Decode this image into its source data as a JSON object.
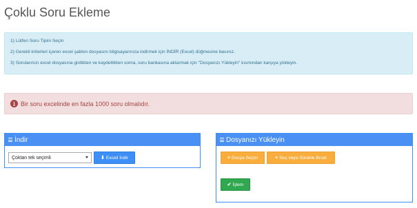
{
  "page": {
    "title": "Çoklu Soru Ekleme"
  },
  "info": {
    "lines": [
      "1) Lütfen Soru Tipini Seçin",
      "2) Gerekli kriterleri içeren excel şablon dosyasını bilgisayarınıza indirmek için İNDİR (Excel) düğmesine basınız.",
      "3) Sorularınızı excel dosyasına girdikten ve kaydettikten sonra, soru bankasına aktarmak için \"Dosyanızı Yükleyin\" kısmından karşıya yükleyin."
    ]
  },
  "alert": {
    "icon": "info-circle-icon",
    "text": "Bir soru excelinde en fazla 1000 soru olmalıdır."
  },
  "download_panel": {
    "title": "İndir",
    "select_value": "Çoktan tek seçimli",
    "button_label": "Exceli İndir",
    "button_icon": "download-icon"
  },
  "upload_panel": {
    "title": "Dosyanızı Yükleyin",
    "choose_label": "Dosya Seçici",
    "drag_label": "Seç veya Sürekle Bırak",
    "process_label": "İşlem",
    "button_icon": "plus-icon",
    "process_icon": "check-icon"
  },
  "colors": {
    "info_bg": "#d9edf7",
    "alert_bg": "#f2dede",
    "panel_header": "#4a90f4",
    "blue_button": "#3e8ef7",
    "orange_button": "#f9ad3c",
    "green_button": "#2fa84f"
  }
}
